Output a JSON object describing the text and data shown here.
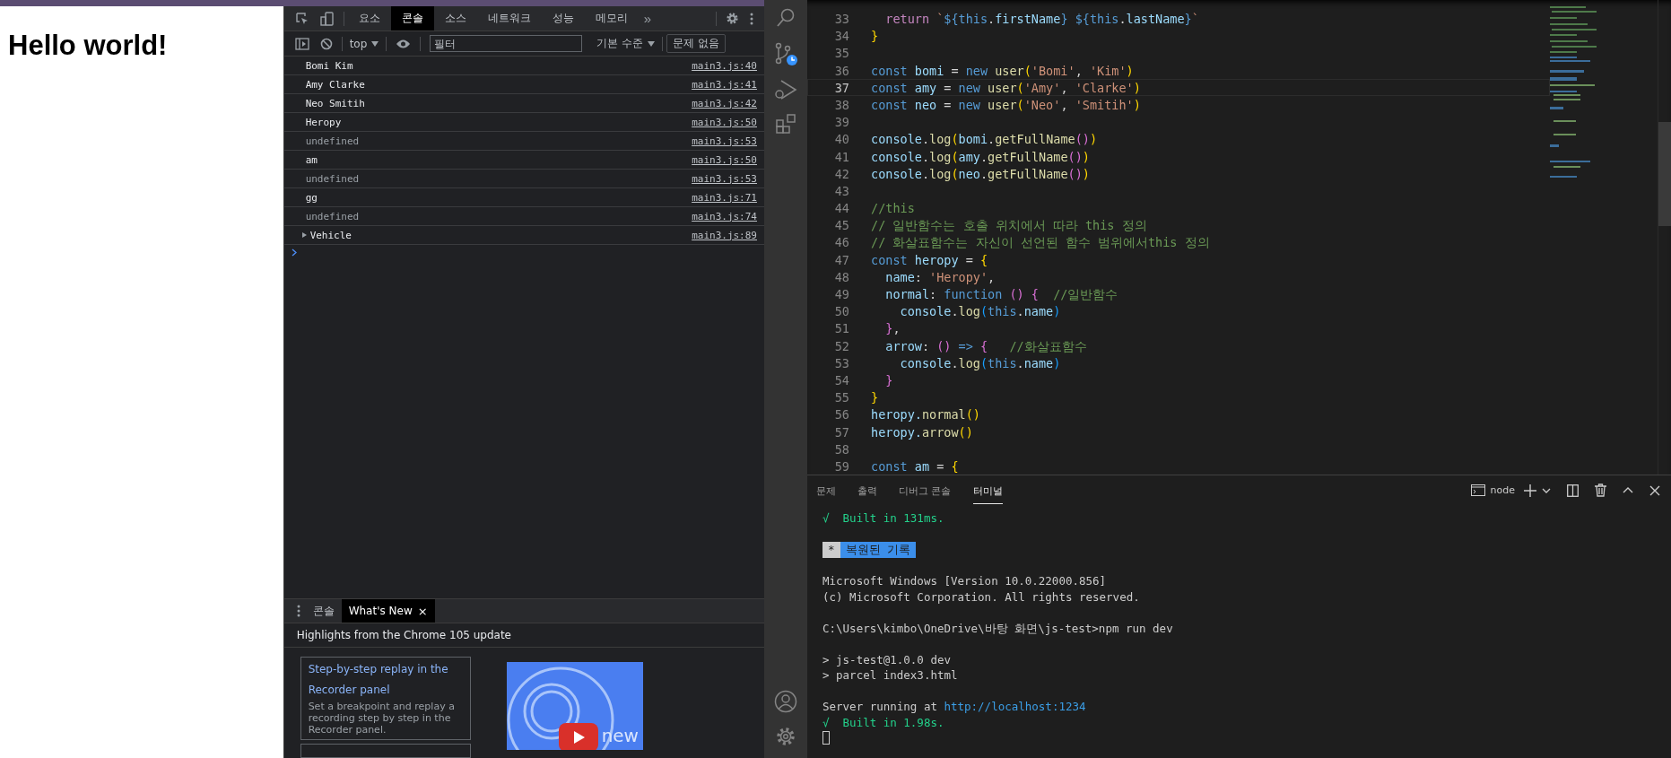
{
  "page": {
    "heading": "Hello world!"
  },
  "devtools": {
    "tabs": [
      {
        "label": "요소",
        "selected": false
      },
      {
        "label": "콘솔",
        "selected": true
      },
      {
        "label": "소스",
        "selected": false
      },
      {
        "label": "네트워크",
        "selected": false
      },
      {
        "label": "성능",
        "selected": false
      },
      {
        "label": "메모리",
        "selected": false
      }
    ],
    "more_tabs": "»",
    "toolbar": {
      "context": "top",
      "filter_placeholder": "필터",
      "levels": "기본 수준",
      "issues": "문제 없음"
    },
    "console_rows": [
      {
        "text": "Bomi Kim",
        "source": "main3.js:40",
        "kind": "log"
      },
      {
        "text": "Amy Clarke",
        "source": "main3.js:41",
        "kind": "log"
      },
      {
        "text": "Neo Smitih",
        "source": "main3.js:42",
        "kind": "log"
      },
      {
        "text": "Heropy",
        "source": "main3.js:50",
        "kind": "log"
      },
      {
        "text": "undefined",
        "source": "main3.js:53",
        "kind": "undefined"
      },
      {
        "text": "am",
        "source": "main3.js:50",
        "kind": "log"
      },
      {
        "text": "undefined",
        "source": "main3.js:53",
        "kind": "undefined"
      },
      {
        "text": "gg",
        "source": "main3.js:71",
        "kind": "log"
      },
      {
        "text": "undefined",
        "source": "main3.js:74",
        "kind": "undefined"
      },
      {
        "text": "Vehicle",
        "source": "main3.js:89",
        "kind": "object"
      }
    ],
    "drawer": {
      "tabs": [
        {
          "label": "콘솔",
          "selected": false,
          "closable": false
        },
        {
          "label": "What's New",
          "selected": true,
          "closable": true
        }
      ],
      "close": "×",
      "header": "Highlights from the Chrome 105 update",
      "card": {
        "title": "Step-by-step replay in the Recorder panel",
        "description": "Set a breakpoint and replay a recording step by step in the Recorder panel."
      },
      "video_caption": "new"
    }
  },
  "editor": {
    "lines": [
      {
        "number": "33",
        "current": false,
        "tokens": [
          {
            "text": "  return ",
            "kind": "control"
          },
          {
            "text": "`",
            "kind": "string"
          },
          {
            "text": "${this",
            "kind": "keyword"
          },
          {
            "text": ".",
            "kind": "punctuation"
          },
          {
            "text": "firstName",
            "kind": "variable"
          },
          {
            "text": "} ${this",
            "kind": "keyword"
          },
          {
            "text": ".",
            "kind": "punctuation"
          },
          {
            "text": "lastName",
            "kind": "variable"
          },
          {
            "text": "}",
            "kind": "keyword"
          },
          {
            "text": "`",
            "kind": "string"
          }
        ]
      },
      {
        "number": "34",
        "current": false,
        "tokens": [
          {
            "text": "}",
            "kind": "bracket1"
          }
        ]
      },
      {
        "number": "35",
        "current": false
      },
      {
        "number": "36",
        "current": false,
        "tokens": [
          {
            "text": "const ",
            "kind": "keyword"
          },
          {
            "text": "bomi",
            "kind": "variable"
          },
          {
            "text": " = ",
            "kind": "punctuation"
          },
          {
            "text": "new ",
            "kind": "keyword"
          },
          {
            "text": "user",
            "kind": "function"
          },
          {
            "text": "(",
            "kind": "bracket1"
          },
          {
            "text": "'Bomi'",
            "kind": "string"
          },
          {
            "text": ", ",
            "kind": "punctuation"
          },
          {
            "text": "'Kim'",
            "kind": "string"
          },
          {
            "text": ")",
            "kind": "bracket1"
          }
        ]
      },
      {
        "number": "37",
        "current": true,
        "tokens": [
          {
            "text": "const ",
            "kind": "keyword"
          },
          {
            "text": "amy",
            "kind": "variable"
          },
          {
            "text": " = ",
            "kind": "punctuation"
          },
          {
            "text": "new ",
            "kind": "keyword"
          },
          {
            "text": "user",
            "kind": "function"
          },
          {
            "text": "(",
            "kind": "bracket1"
          },
          {
            "text": "'Amy'",
            "kind": "string"
          },
          {
            "text": ", ",
            "kind": "punctuation"
          },
          {
            "text": "'Clarke'",
            "kind": "string"
          },
          {
            "text": ")",
            "kind": "bracket1"
          }
        ]
      },
      {
        "number": "38",
        "current": false,
        "tokens": [
          {
            "text": "const ",
            "kind": "keyword"
          },
          {
            "text": "neo",
            "kind": "variable"
          },
          {
            "text": " = ",
            "kind": "punctuation"
          },
          {
            "text": "new ",
            "kind": "keyword"
          },
          {
            "text": "user",
            "kind": "function"
          },
          {
            "text": "(",
            "kind": "bracket1"
          },
          {
            "text": "'Neo'",
            "kind": "string"
          },
          {
            "text": ", ",
            "kind": "punctuation"
          },
          {
            "text": "'Smitih'",
            "kind": "string"
          },
          {
            "text": ")",
            "kind": "bracket1"
          }
        ]
      },
      {
        "number": "39",
        "current": false
      },
      {
        "number": "40",
        "current": false,
        "tokens": [
          {
            "text": "console",
            "kind": "variable"
          },
          {
            "text": ".",
            "kind": "punctuation"
          },
          {
            "text": "log",
            "kind": "function"
          },
          {
            "text": "(",
            "kind": "bracket1"
          },
          {
            "text": "bomi",
            "kind": "variable"
          },
          {
            "text": ".",
            "kind": "punctuation"
          },
          {
            "text": "getFullName",
            "kind": "function"
          },
          {
            "text": "()",
            "kind": "bracket2"
          },
          {
            "text": ")",
            "kind": "bracket1"
          }
        ]
      },
      {
        "number": "41",
        "current": false,
        "tokens": [
          {
            "text": "console",
            "kind": "variable"
          },
          {
            "text": ".",
            "kind": "punctuation"
          },
          {
            "text": "log",
            "kind": "function"
          },
          {
            "text": "(",
            "kind": "bracket1"
          },
          {
            "text": "amy",
            "kind": "variable"
          },
          {
            "text": ".",
            "kind": "punctuation"
          },
          {
            "text": "getFullName",
            "kind": "function"
          },
          {
            "text": "()",
            "kind": "bracket2"
          },
          {
            "text": ")",
            "kind": "bracket1"
          }
        ]
      },
      {
        "number": "42",
        "current": false,
        "tokens": [
          {
            "text": "console",
            "kind": "variable"
          },
          {
            "text": ".",
            "kind": "punctuation"
          },
          {
            "text": "log",
            "kind": "function"
          },
          {
            "text": "(",
            "kind": "bracket1"
          },
          {
            "text": "neo",
            "kind": "variable"
          },
          {
            "text": ".",
            "kind": "punctuation"
          },
          {
            "text": "getFullName",
            "kind": "function"
          },
          {
            "text": "()",
            "kind": "bracket2"
          },
          {
            "text": ")",
            "kind": "bracket1"
          }
        ]
      },
      {
        "number": "43",
        "current": false
      },
      {
        "number": "44",
        "current": false,
        "tokens": [
          {
            "text": "//this",
            "kind": "comment"
          }
        ]
      },
      {
        "number": "45",
        "current": false,
        "tokens": [
          {
            "text": "// 일반함수는 호출 위치에서 따라 this 정의",
            "kind": "comment"
          }
        ]
      },
      {
        "number": "46",
        "current": false,
        "tokens": [
          {
            "text": "// 화살표함수는 자신이 선언된 함수 범위에서this 정의",
            "kind": "comment"
          }
        ]
      },
      {
        "number": "47",
        "current": false,
        "tokens": [
          {
            "text": "const ",
            "kind": "keyword"
          },
          {
            "text": "heropy",
            "kind": "variable"
          },
          {
            "text": " = ",
            "kind": "punctuation"
          },
          {
            "text": "{",
            "kind": "bracket1"
          }
        ]
      },
      {
        "number": "48",
        "current": false,
        "tokens": [
          {
            "text": "  name",
            "kind": "variable"
          },
          {
            "text": ": ",
            "kind": "punctuation"
          },
          {
            "text": "'Heropy'",
            "kind": "string"
          },
          {
            "text": ",",
            "kind": "punctuation"
          }
        ]
      },
      {
        "number": "49",
        "current": false,
        "tokens": [
          {
            "text": "  normal",
            "kind": "variable"
          },
          {
            "text": ": ",
            "kind": "punctuation"
          },
          {
            "text": "function ",
            "kind": "keyword"
          },
          {
            "text": "() {",
            "kind": "bracket2"
          },
          {
            "text": "  //일반함수",
            "kind": "comment"
          }
        ]
      },
      {
        "number": "50",
        "current": false,
        "tokens": [
          {
            "text": "    console",
            "kind": "variable"
          },
          {
            "text": ".",
            "kind": "punctuation"
          },
          {
            "text": "log",
            "kind": "function"
          },
          {
            "text": "(",
            "kind": "bracket3"
          },
          {
            "text": "this",
            "kind": "keyword"
          },
          {
            "text": ".",
            "kind": "punctuation"
          },
          {
            "text": "name",
            "kind": "variable"
          },
          {
            "text": ")",
            "kind": "bracket3"
          }
        ]
      },
      {
        "number": "51",
        "current": false,
        "tokens": [
          {
            "text": "  }",
            "kind": "bracket2"
          },
          {
            "text": ",",
            "kind": "punctuation"
          }
        ]
      },
      {
        "number": "52",
        "current": false,
        "tokens": [
          {
            "text": "  arrow",
            "kind": "variable"
          },
          {
            "text": ": ",
            "kind": "punctuation"
          },
          {
            "text": "() ",
            "kind": "bracket2"
          },
          {
            "text": "=> ",
            "kind": "keyword"
          },
          {
            "text": "{",
            "kind": "bracket2"
          },
          {
            "text": "   //화살표함수",
            "kind": "comment"
          }
        ]
      },
      {
        "number": "53",
        "current": false,
        "tokens": [
          {
            "text": "    console",
            "kind": "variable"
          },
          {
            "text": ".",
            "kind": "punctuation"
          },
          {
            "text": "log",
            "kind": "function"
          },
          {
            "text": "(",
            "kind": "bracket3"
          },
          {
            "text": "this",
            "kind": "keyword"
          },
          {
            "text": ".",
            "kind": "punctuation"
          },
          {
            "text": "name",
            "kind": "variable"
          },
          {
            "text": ")",
            "kind": "bracket3"
          }
        ]
      },
      {
        "number": "54",
        "current": false,
        "tokens": [
          {
            "text": "  }",
            "kind": "bracket2"
          }
        ]
      },
      {
        "number": "55",
        "current": false,
        "tokens": [
          {
            "text": "}",
            "kind": "bracket1"
          }
        ]
      },
      {
        "number": "56",
        "current": false,
        "tokens": [
          {
            "text": "heropy.",
            "kind": "variable"
          },
          {
            "text": "normal",
            "kind": "function"
          },
          {
            "text": "()",
            "kind": "bracket1"
          }
        ]
      },
      {
        "number": "57",
        "current": false,
        "tokens": [
          {
            "text": "heropy.",
            "kind": "variable"
          },
          {
            "text": "arrow",
            "kind": "function"
          },
          {
            "text": "()",
            "kind": "bracket1"
          }
        ]
      },
      {
        "number": "58",
        "current": false
      },
      {
        "number": "59",
        "current": false,
        "tokens": [
          {
            "text": "const ",
            "kind": "keyword"
          },
          {
            "text": "am",
            "kind": "variable"
          },
          {
            "text": " = ",
            "kind": "punctuation"
          },
          {
            "text": "{",
            "kind": "bracket1"
          }
        ]
      }
    ]
  },
  "panel": {
    "tabs": [
      {
        "label": "문제",
        "selected": false
      },
      {
        "label": "출력",
        "selected": false
      },
      {
        "label": "디버그 콘솔",
        "selected": false
      },
      {
        "label": "터미널",
        "selected": true
      }
    ],
    "shell": "node",
    "terminal_groups": [
      [
        {
          "kind": "success",
          "text": "√  Built in 131ms."
        }
      ],
      [
        {
          "kind": "badge",
          "mark": "*",
          "text": "복원된 기록"
        }
      ],
      [
        {
          "kind": "plain",
          "text": "Microsoft Windows [Version 10.0.22000.856]"
        },
        {
          "kind": "plain",
          "text": "(c) Microsoft Corporation. All rights reserved."
        }
      ],
      [
        {
          "kind": "plain",
          "text": "C:\\Users\\kimbo\\OneDrive\\바탕 화면\\js-test>npm run dev"
        }
      ],
      [
        {
          "kind": "plain",
          "text": "> js-test@1.0.0 dev"
        },
        {
          "kind": "plain",
          "text": "> parcel index3.html"
        }
      ],
      [
        {
          "kind": "link",
          "text": "Server running at",
          "link": "http://localhost:1234"
        },
        {
          "kind": "success",
          "text": "√  Built in 1.98s."
        },
        {
          "kind": "cursor"
        }
      ]
    ]
  }
}
